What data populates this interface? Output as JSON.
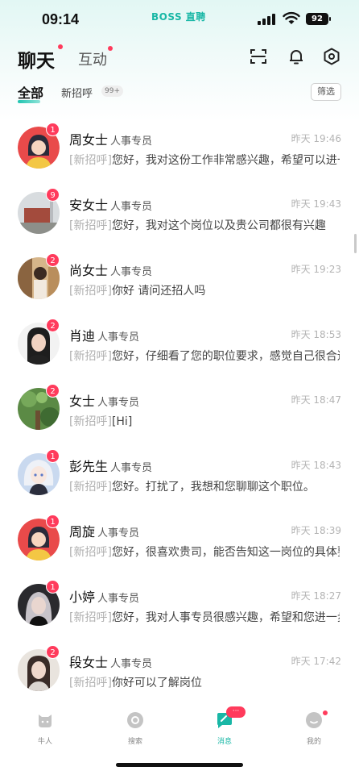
{
  "status_bar": {
    "time": "09:14",
    "brand": "BOSS 直聘",
    "battery": "92"
  },
  "header": {
    "tab_chat": "聊天",
    "tab_interact": "互动",
    "icons": [
      "scan-icon",
      "bell-icon",
      "settings-icon"
    ]
  },
  "filters": {
    "all": "全部",
    "new_greet": "新招呼",
    "new_count": "99+",
    "filter_button": "筛选"
  },
  "chats": [
    {
      "name": "周女士",
      "role": "人事专员",
      "time": "昨天 19:46",
      "badge": "1",
      "tag": "[新招呼]",
      "message": "您好，我对这份工作非常感兴趣，希望可以进一步了解",
      "avatar": "cartoon-red"
    },
    {
      "name": "安女士",
      "role": "人事专员",
      "time": "昨天 19:43",
      "badge": "9",
      "tag": "[新招呼]",
      "message": "您好，我对这个岗位以及贵公司都很有兴趣",
      "avatar": "building"
    },
    {
      "name": "尚女士",
      "role": "人事专员",
      "time": "昨天 19:23",
      "badge": "2",
      "tag": "[新招呼]",
      "message": "你好 请问还招人吗",
      "avatar": "photo-warm"
    },
    {
      "name": "肖迪",
      "role": "人事专员",
      "time": "昨天 18:53",
      "badge": "2",
      "tag": "[新招呼]",
      "message": "您好，仔细看了您的职位要求，感觉自己很合适",
      "avatar": "portrait"
    },
    {
      "name": "女士",
      "role": "人事专员",
      "time": "昨天 18:47",
      "badge": "2",
      "tag": "[新招呼]",
      "message": "[Hi]",
      "avatar": "green"
    },
    {
      "name": "彭先生",
      "role": "人事专员",
      "time": "昨天 18:43",
      "badge": "1",
      "tag": "[新招呼]",
      "message": "您好。打扰了，我想和您聊聊这个职位。",
      "avatar": "anime"
    },
    {
      "name": "周旋",
      "role": "人事专员",
      "time": "昨天 18:39",
      "badge": "1",
      "tag": "[新招呼]",
      "message": "您好，很喜欢贵司，能否告知这一岗位的具体要求",
      "avatar": "cartoon-red"
    },
    {
      "name": "小婷",
      "role": "人事专员",
      "time": "昨天 18:27",
      "badge": "1",
      "tag": "[新招呼]",
      "message": "您好，我对人事专员很感兴趣，希望和您进一步沟通",
      "avatar": "dark-portrait"
    },
    {
      "name": "段女士",
      "role": "人事专员",
      "time": "昨天 17:42",
      "badge": "2",
      "tag": "[新招呼]",
      "message": "你好可以了解岗位",
      "avatar": "portrait-2"
    }
  ],
  "bottom_nav": [
    {
      "label": "牛人",
      "icon": "cat-icon",
      "active": false
    },
    {
      "label": "搜索",
      "icon": "search-icon",
      "active": false
    },
    {
      "label": "消息",
      "icon": "message-icon",
      "active": true,
      "bubble": "···"
    },
    {
      "label": "我的",
      "icon": "profile-icon",
      "active": false
    }
  ],
  "colors": {
    "accent": "#19b7a6",
    "badge": "#ff3b5c"
  }
}
